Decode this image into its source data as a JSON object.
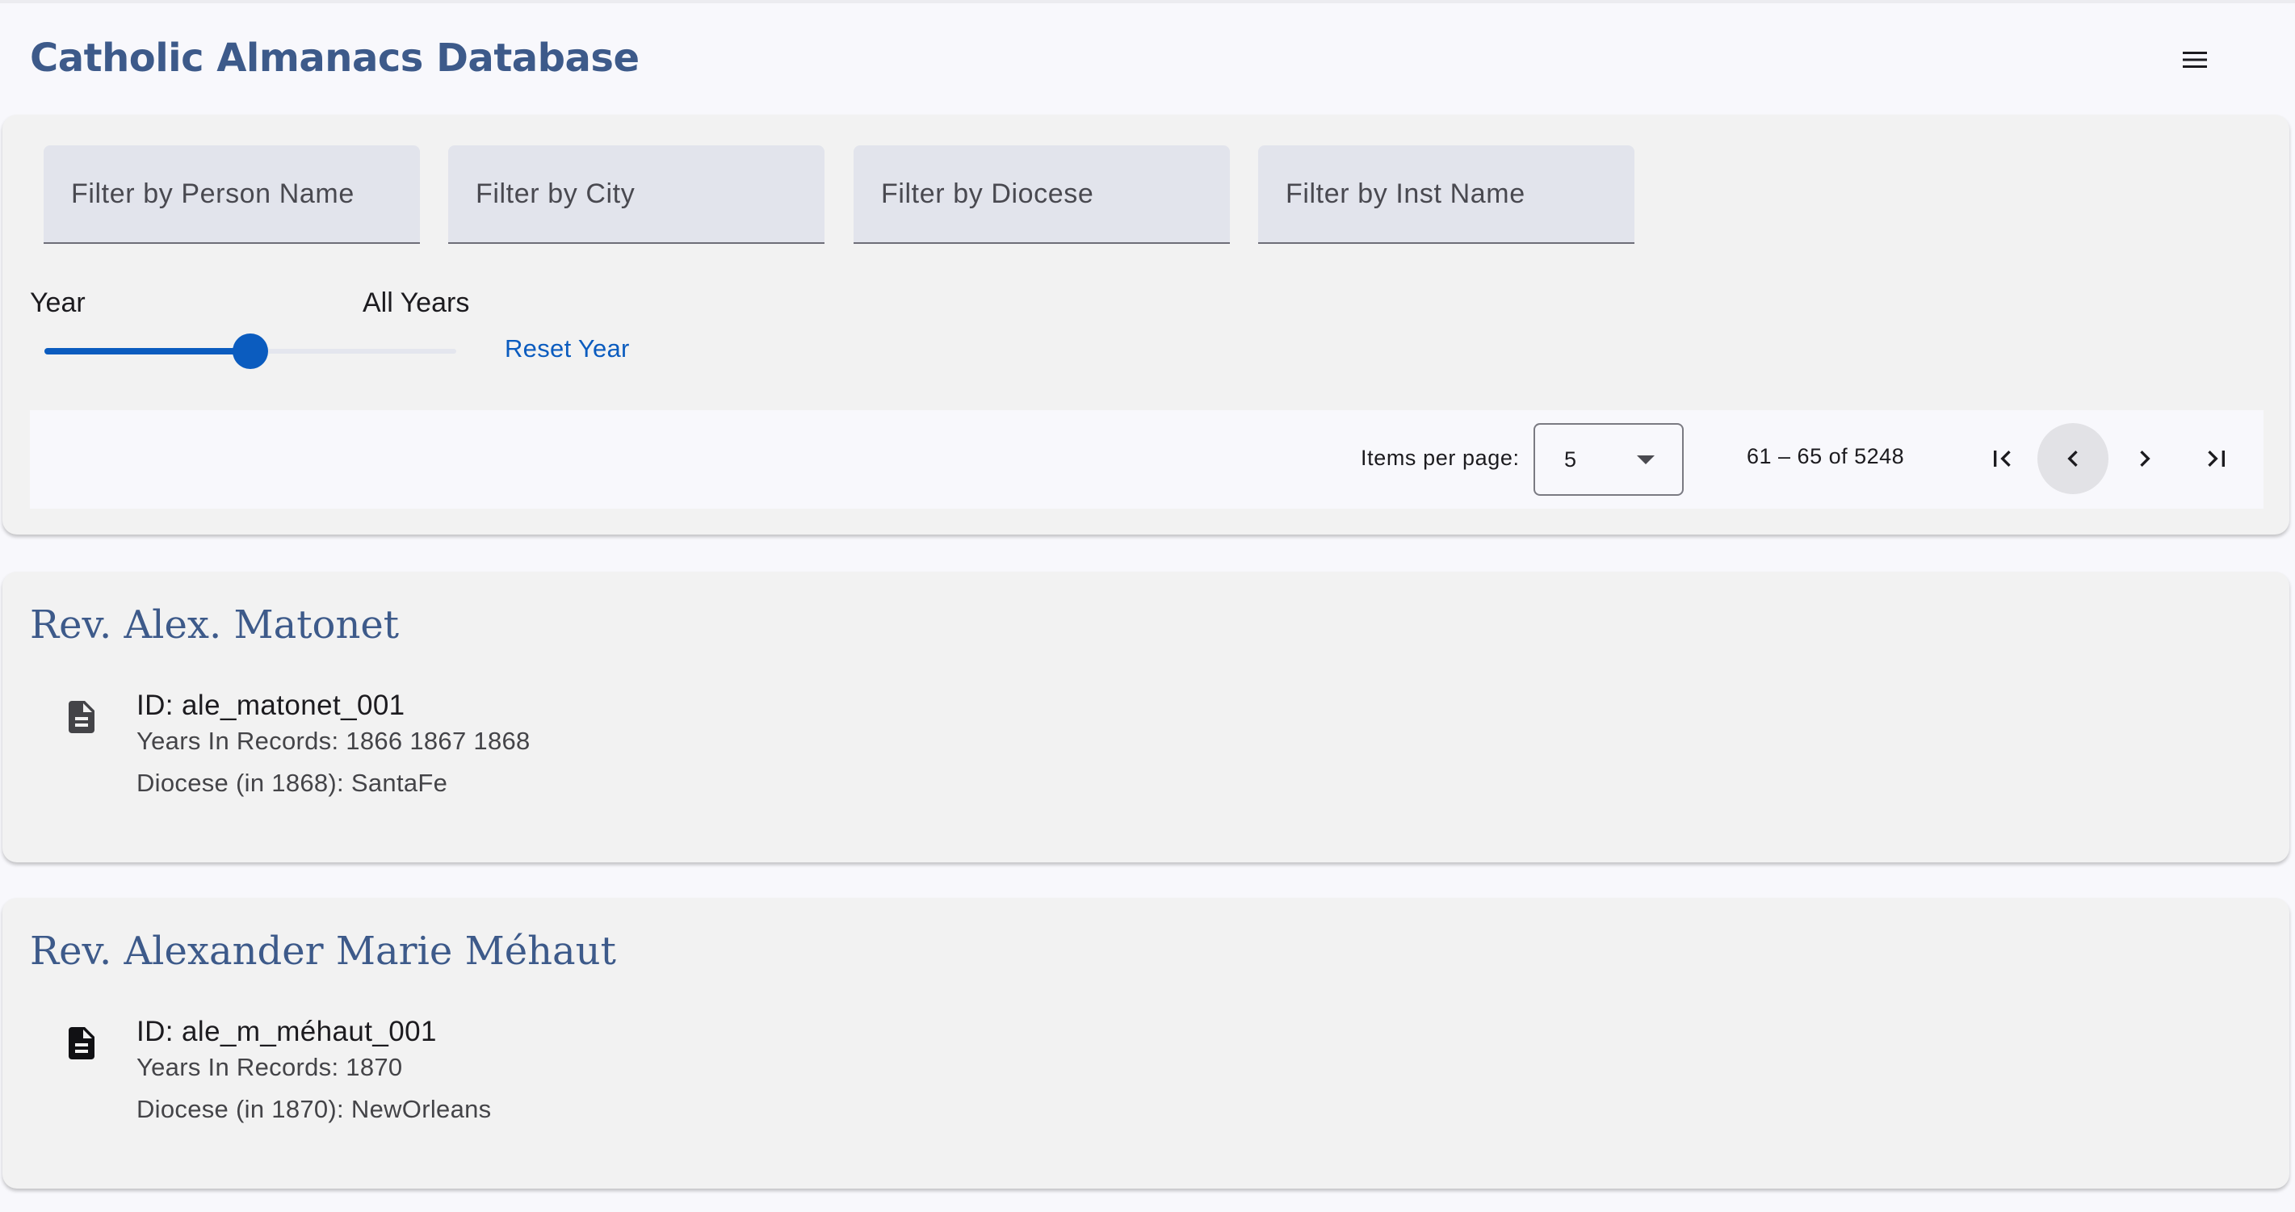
{
  "header": {
    "title": "Catholic Almanacs Database",
    "menu_icon": "menu-icon"
  },
  "filters": {
    "person_name_placeholder": "Filter by Person Name",
    "city_placeholder": "Filter by City",
    "diocese_placeholder": "Filter by Diocese",
    "inst_name_placeholder": "Filter by Inst Name"
  },
  "year": {
    "label": "Year",
    "value_label": "All Years",
    "slider_fraction": 0.5,
    "reset_label": "Reset Year"
  },
  "paginator": {
    "items_per_page_label": "Items per page:",
    "items_per_page_value": "5",
    "range_label": "61 – 65 of 5248",
    "icons": [
      "first-page-icon",
      "previous-page-icon",
      "next-page-icon",
      "last-page-icon"
    ]
  },
  "records": [
    {
      "name": "Rev. Alex. Matonet",
      "id": "ID: ale_matonet_001",
      "years": "Years In Records: 1866 1867 1868",
      "diocese": "Diocese (in 1868): SantaFe",
      "icon": "document-icon"
    },
    {
      "name": "Rev. Alexander Marie Méhaut",
      "id": "ID: ale_m_méhaut_001",
      "years": "Years In Records: 1870",
      "diocese": "Diocese (in 1870): NewOrleans",
      "icon": "document-icon"
    }
  ],
  "colors": {
    "title": "#3d5a8a",
    "accent": "#0b5cbf",
    "card_bg": "#f2f2f2",
    "field_bg": "#e2e4ec"
  }
}
